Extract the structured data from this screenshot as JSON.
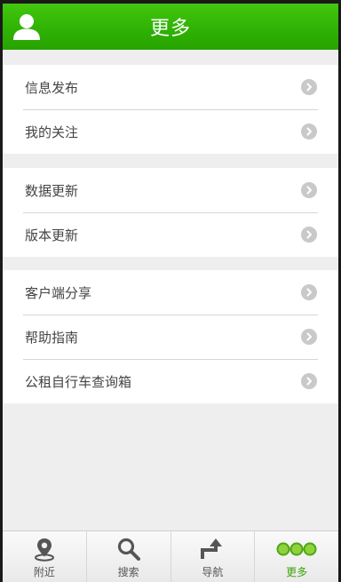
{
  "header": {
    "title": "更多",
    "avatar_icon": "user-icon"
  },
  "menu_groups": [
    {
      "items": [
        {
          "label": "信息发布"
        },
        {
          "label": "我的关注"
        }
      ]
    },
    {
      "items": [
        {
          "label": "数据更新"
        },
        {
          "label": "版本更新"
        }
      ]
    },
    {
      "items": [
        {
          "label": "客户端分享"
        },
        {
          "label": "帮助指南"
        },
        {
          "label": "公租自行车查询箱"
        }
      ]
    }
  ],
  "tabbar": {
    "tabs": [
      {
        "label": "附近",
        "icon": "location-pin-icon"
      },
      {
        "label": "搜索",
        "icon": "search-icon"
      },
      {
        "label": "导航",
        "icon": "turn-arrow-icon"
      },
      {
        "label": "更多",
        "icon": "more-dots-icon",
        "active": true
      }
    ]
  },
  "colors": {
    "header_green": "#30b204",
    "active_tab": "#3aa40a",
    "chevron_gray": "#c9c9c9"
  }
}
